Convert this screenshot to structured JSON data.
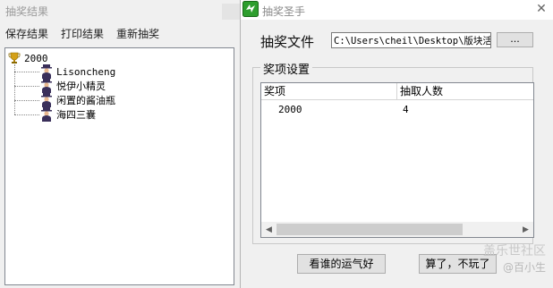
{
  "results_window": {
    "title": "抽奖结果",
    "menu": [
      "保存结果",
      "打印结果",
      "重新抽奖"
    ],
    "tree": {
      "root": {
        "label": "2000",
        "icon": "trophy-icon"
      },
      "children": [
        {
          "label": "Lisoncheng",
          "icon": "person-icon"
        },
        {
          "label": "悦伊小精灵",
          "icon": "person-icon"
        },
        {
          "label": "闲置的酱油瓶",
          "icon": "person-icon"
        },
        {
          "label": "海四三囊",
          "icon": "person-icon"
        }
      ]
    }
  },
  "main_window": {
    "title": "抽奖圣手",
    "close_glyph": "✕",
    "file": {
      "label": "抽奖文件",
      "value": "C:\\Users\\cheil\\Desktop\\版块活",
      "browse_label": "..."
    },
    "group_title": "奖项设置",
    "table": {
      "columns": [
        "奖项",
        "抽取人数"
      ],
      "rows": [
        [
          "2000",
          "4"
        ]
      ]
    },
    "scroll_left": "◀",
    "scroll_right": "▶",
    "buttons": {
      "lucky": "看谁的运气好",
      "quit": "算了，不玩了"
    }
  },
  "watermark": {
    "line1": "盖乐世社区",
    "line2": "@百小生"
  },
  "colors": {
    "app_icon_green": "#2e9e2e",
    "trophy_gold": "#d4a017",
    "person_dark": "#3a2f5a"
  }
}
